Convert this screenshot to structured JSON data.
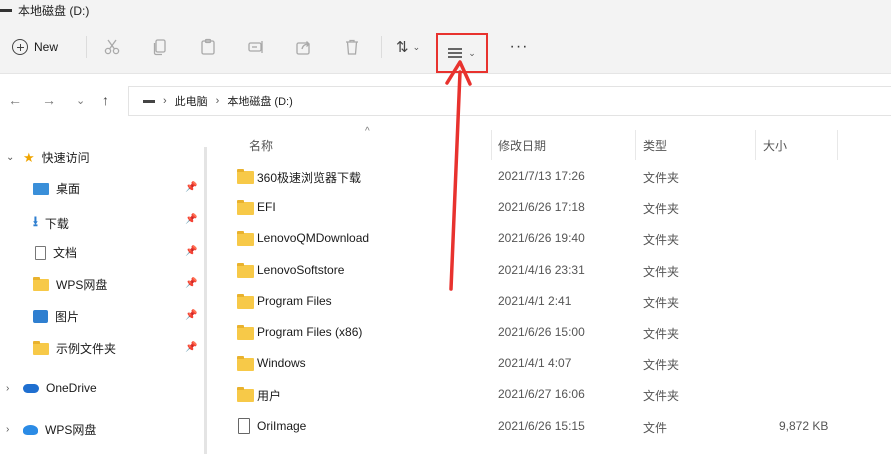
{
  "window": {
    "title": "本地磁盘 (D:)"
  },
  "toolbar": {
    "new_label": "New",
    "more_label": "···",
    "icons": [
      "cut-icon",
      "copy-icon",
      "paste-icon",
      "rename-icon",
      "share-icon",
      "delete-icon",
      "sort-icon",
      "view-icon"
    ],
    "annotation_color": "#e8322e"
  },
  "navigation": {
    "back": "←",
    "forward": "→",
    "recent": "⌄",
    "up": "↑"
  },
  "address": {
    "crumbs": [
      "此电脑",
      "本地磁盘 (D:)"
    ],
    "separator": "›"
  },
  "sidebar": {
    "quick_access": "快速访问",
    "items": [
      {
        "label": "桌面",
        "icon": "desktop-icon"
      },
      {
        "label": "下载",
        "icon": "download-icon"
      },
      {
        "label": "文档",
        "icon": "document-icon"
      },
      {
        "label": "WPS网盘",
        "icon": "folder-icon"
      },
      {
        "label": "图片",
        "icon": "pictures-icon"
      },
      {
        "label": "示例文件夹",
        "icon": "folder-icon"
      }
    ],
    "onedrive": "OneDrive",
    "wps_drive": "WPS网盘"
  },
  "columns": {
    "name": "名称",
    "date": "修改日期",
    "type": "类型",
    "size": "大小"
  },
  "files": [
    {
      "name": "360极速浏览器下载",
      "date": "2021/7/13 17:26",
      "type": "文件夹",
      "size": ""
    },
    {
      "name": "EFI",
      "date": "2021/6/26 17:18",
      "type": "文件夹",
      "size": ""
    },
    {
      "name": "LenovoQMDownload",
      "date": "2021/6/26 19:40",
      "type": "文件夹",
      "size": ""
    },
    {
      "name": "LenovoSoftstore",
      "date": "2021/4/16 23:31",
      "type": "文件夹",
      "size": ""
    },
    {
      "name": "Program Files",
      "date": "2021/4/1 2:41",
      "type": "文件夹",
      "size": ""
    },
    {
      "name": "Program Files (x86)",
      "date": "2021/6/26 15:00",
      "type": "文件夹",
      "size": ""
    },
    {
      "name": "Windows",
      "date": "2021/4/1 4:07",
      "type": "文件夹",
      "size": ""
    },
    {
      "name": "用户",
      "date": "2021/6/27 16:06",
      "type": "文件夹",
      "size": ""
    },
    {
      "name": "OriImage",
      "date": "2021/6/26 15:15",
      "type": "文件",
      "size": "9,872 KB"
    }
  ]
}
